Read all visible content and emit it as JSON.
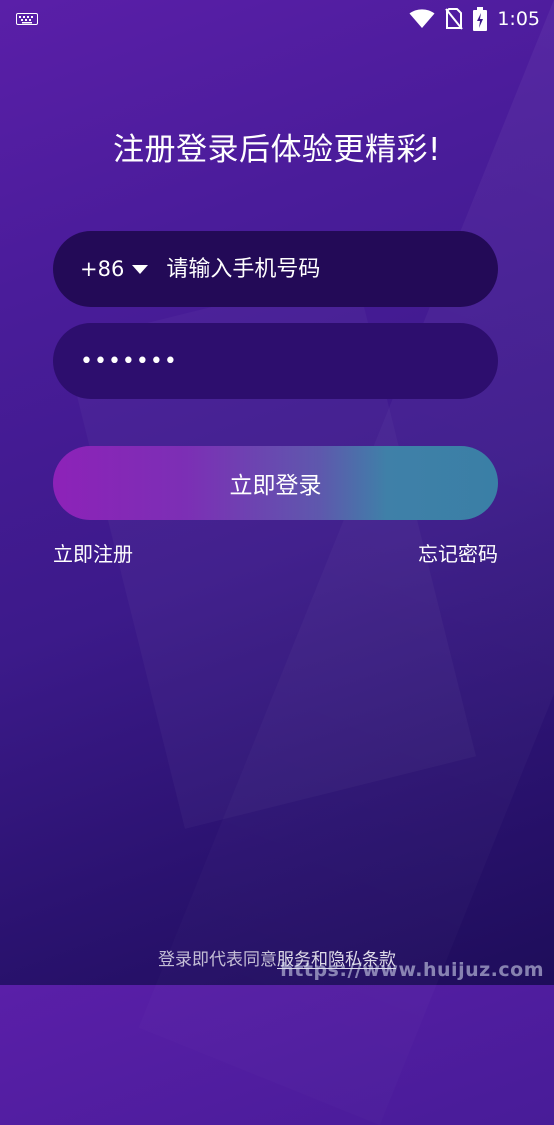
{
  "status_bar": {
    "time": "1:05",
    "icons": [
      "keyboard-icon",
      "wifi-icon",
      "no-sim-icon",
      "battery-charging-icon"
    ]
  },
  "headline": "注册登录后体验更精彩!",
  "phone_field": {
    "country_code": "+86",
    "placeholder": "请输入手机号码",
    "value": ""
  },
  "password_field": {
    "value": "•••••••"
  },
  "login_button": {
    "label": "立即登录"
  },
  "links": {
    "register": "立即注册",
    "forgot_password": "忘记密码"
  },
  "agreement": {
    "prefix": "登录即代表同意",
    "terms_link": "服务和隐私条款"
  },
  "watermark": "https://www.huijuz.com",
  "colors": {
    "background_top": "#5a1fa8",
    "background_bottom": "#1e0d5a",
    "phone_field_bg": "#230a57",
    "password_field_bg": "#2d0e6e",
    "button_gradient_start": "#8d22b8",
    "button_gradient_end": "#3a7fa6"
  }
}
